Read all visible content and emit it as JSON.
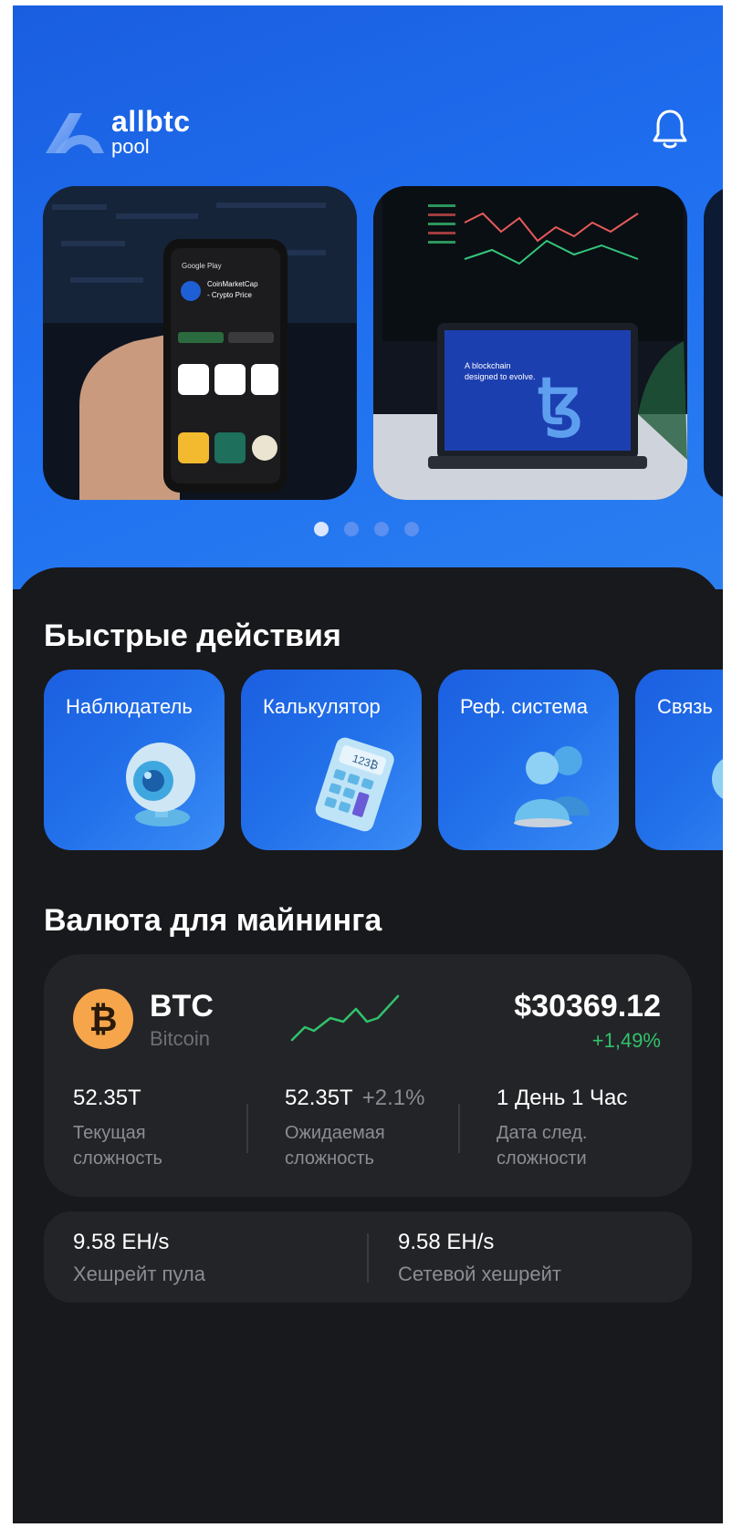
{
  "brand": {
    "name_line1": "allbtc",
    "name_line2": "pool"
  },
  "header": {
    "notification_icon": "bell-icon"
  },
  "carousel": {
    "slides": [
      {
        "image": "phone-coinmarketcap-photo"
      },
      {
        "image": "laptop-trading-photo"
      },
      {
        "image": "partial-slide"
      }
    ],
    "dots": 4,
    "active_index": 0
  },
  "quick_actions": {
    "title": "Быстрые действия",
    "items": [
      {
        "label": "Наблюдатель",
        "icon": "webcam-icon"
      },
      {
        "label": "Калькулятор",
        "icon": "calculator-icon"
      },
      {
        "label": "Реф. система",
        "icon": "users-icon"
      },
      {
        "label": "Связь",
        "icon": "chat-icon"
      }
    ]
  },
  "mining_currency": {
    "title": "Валюта для майнинга",
    "coin": {
      "ticker": "BTC",
      "name": "Bitcoin",
      "price": "$30369.12",
      "change": "+1,49%",
      "icon": "bitcoin-icon",
      "change_color": "#30c26c"
    },
    "stats": [
      {
        "value": "52.35T",
        "sub": "",
        "label": "Текущая сложность"
      },
      {
        "value": "52.35T",
        "sub": "+2.1%",
        "label": "Ожидаемая сложность"
      },
      {
        "value": "1 День 1 Час",
        "sub": "",
        "label": "Дата след. сложности"
      }
    ],
    "hashrates": [
      {
        "value": "9.58 EH/s",
        "label": "Хешрейт пула"
      },
      {
        "value": "9.58 EH/s",
        "label": "Сетевой хешрейт"
      }
    ]
  },
  "colors": {
    "accent": "#1f6ff0",
    "background": "#18191c",
    "card": "#232427",
    "positive": "#30c26c"
  }
}
